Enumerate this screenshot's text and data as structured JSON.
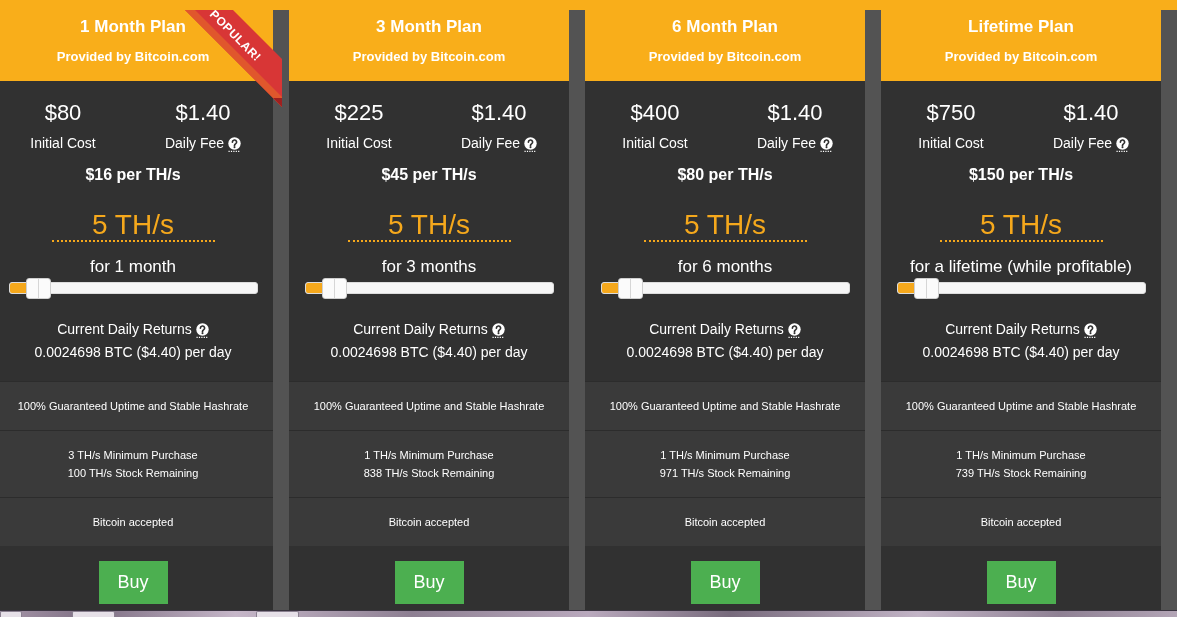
{
  "plans": [
    {
      "title": "1 Month Plan",
      "provider": "Provided by Bitcoin.com",
      "badge": "POPULAR!",
      "initial_cost": {
        "value": "$80",
        "label": "Initial Cost"
      },
      "daily_fee": {
        "value": "$1.40",
        "label": "Daily Fee"
      },
      "price_per_unit": "$16 per TH/s",
      "hashrate": "5 TH/s",
      "duration": "for 1 month",
      "level": 0.065,
      "returns_label": "Current Daily Returns",
      "returns_value": "0.0024698 BTC ($4.40) per day",
      "features": [
        [
          "100% Guaranteed Uptime and Stable Hashrate"
        ],
        [
          "3 TH/s Minimum Purchase",
          "100 TH/s Stock Remaining"
        ],
        [
          "Bitcoin accepted"
        ]
      ],
      "button": "Buy"
    },
    {
      "title": "3 Month Plan",
      "provider": "Provided by Bitcoin.com",
      "initial_cost": {
        "value": "$225",
        "label": "Initial Cost"
      },
      "daily_fee": {
        "value": "$1.40",
        "label": "Daily Fee"
      },
      "price_per_unit": "$45 per TH/s",
      "hashrate": "5 TH/s",
      "duration": "for 3 months",
      "level": 0.065,
      "returns_label": "Current Daily Returns",
      "returns_value": "0.0024698 BTC ($4.40) per day",
      "features": [
        [
          "100% Guaranteed Uptime and Stable Hashrate"
        ],
        [
          "1 TH/s Minimum Purchase",
          "838 TH/s Stock Remaining"
        ],
        [
          "Bitcoin accepted"
        ]
      ],
      "button": "Buy"
    },
    {
      "title": "6 Month Plan",
      "provider": "Provided by Bitcoin.com",
      "initial_cost": {
        "value": "$400",
        "label": "Initial Cost"
      },
      "daily_fee": {
        "value": "$1.40",
        "label": "Daily Fee"
      },
      "price_per_unit": "$80 per TH/s",
      "hashrate": "5 TH/s",
      "duration": "for 6 months",
      "level": 0.065,
      "returns_label": "Current Daily Returns",
      "returns_value": "0.0024698 BTC ($4.40) per day",
      "features": [
        [
          "100% Guaranteed Uptime and Stable Hashrate"
        ],
        [
          "1 TH/s Minimum Purchase",
          "971 TH/s Stock Remaining"
        ],
        [
          "Bitcoin accepted"
        ]
      ],
      "button": "Buy"
    },
    {
      "title": "Lifetime Plan",
      "provider": "Provided by Bitcoin.com",
      "initial_cost": {
        "value": "$750",
        "label": "Initial Cost"
      },
      "daily_fee": {
        "value": "$1.40",
        "label": "Daily Fee"
      },
      "price_per_unit": "$150 per TH/s",
      "hashrate": "5 TH/s",
      "duration": "for a lifetime (while profitable)",
      "level": 0.065,
      "returns_label": "Current Daily Returns",
      "returns_value": "0.0024698 BTC ($4.40) per day",
      "features": [
        [
          "100% Guaranteed Uptime and Stable Hashrate"
        ],
        [
          "1 TH/s Minimum Purchase",
          "739 TH/s Stock Remaining"
        ],
        [
          "Bitcoin accepted"
        ]
      ],
      "button": "Buy"
    }
  ]
}
